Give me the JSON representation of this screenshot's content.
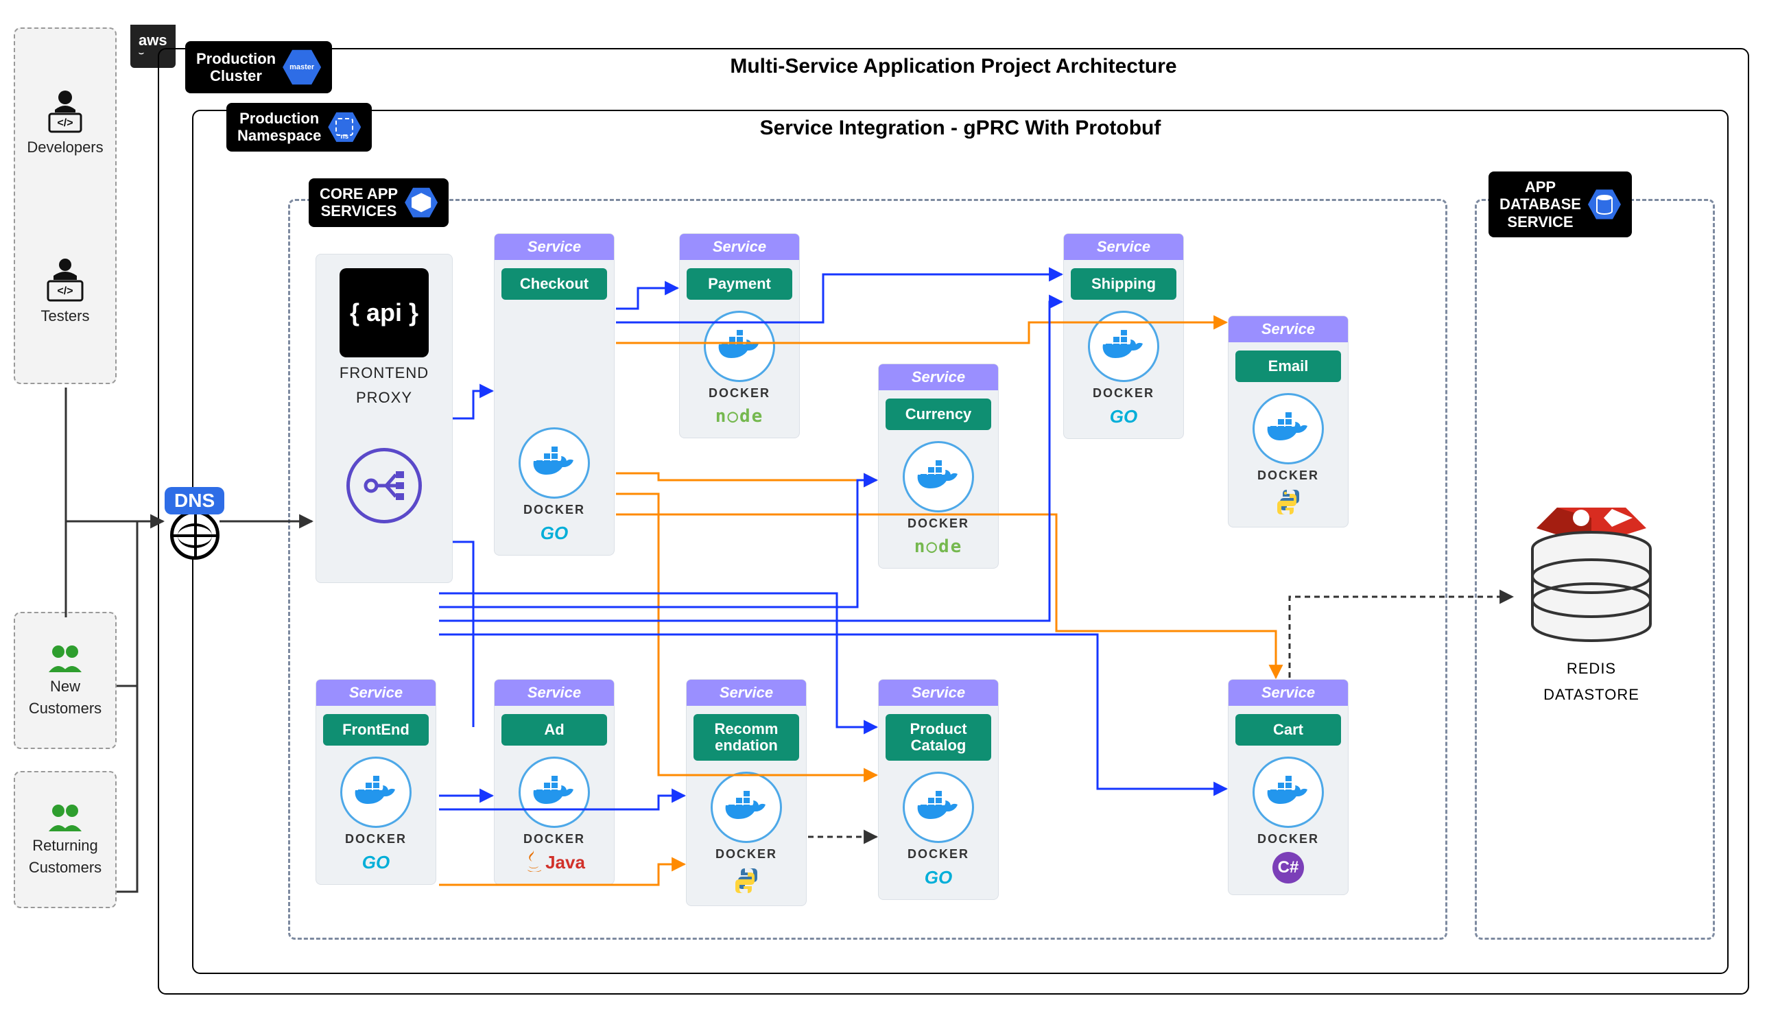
{
  "actors": {
    "developers": "Developers",
    "testers": "Testers",
    "new_customers_l1": "New",
    "new_customers_l2": "Customers",
    "returning_customers_l1": "Returning",
    "returning_customers_l2": "Customers"
  },
  "aws_label": "aws",
  "badges": {
    "prod_cluster_l1": "Production",
    "prod_cluster_l2": "Cluster",
    "prod_cluster_hex": "master",
    "prod_ns_l1": "Production",
    "prod_ns_l2": "Namespace",
    "prod_ns_hex": "ns",
    "core_app_l1": "CORE APP",
    "core_app_l2": "SERVICES",
    "app_db_l1": "APP",
    "app_db_l2": "DATABASE",
    "app_db_l3": "SERVICE"
  },
  "titles": {
    "outer": "Multi-Service Application Project Architecture",
    "inner": "Service Integration - gPRC With Protobuf"
  },
  "dns": "DNS",
  "proxy": {
    "api": "{ api }",
    "label_l1": "FRONTEND",
    "label_l2": "PROXY"
  },
  "svc_head": "Service",
  "docker_label": "DOCKER",
  "services": {
    "checkout": {
      "name": "Checkout",
      "lang": "go",
      "lang_text": "GO"
    },
    "payment": {
      "name": "Payment",
      "lang": "node",
      "lang_text": "n○de"
    },
    "shipping": {
      "name": "Shipping",
      "lang": "go",
      "lang_text": "GO"
    },
    "email": {
      "name": "Email",
      "lang": "py"
    },
    "currency": {
      "name": "Currency",
      "lang": "node",
      "lang_text": "n○de"
    },
    "frontend": {
      "name": "FrontEnd",
      "lang": "go",
      "lang_text": "GO"
    },
    "ad": {
      "name": "Ad",
      "lang": "java",
      "lang_text": "Java"
    },
    "recommendation": {
      "name_l1": "Recomm",
      "name_l2": "endation",
      "lang": "py"
    },
    "product_catalog": {
      "name_l1": "Product",
      "name_l2": "Catalog",
      "lang": "go",
      "lang_text": "GO"
    },
    "cart": {
      "name": "Cart",
      "lang": "cs",
      "lang_text": "C#"
    }
  },
  "redis": {
    "l1": "REDIS",
    "l2": "DATASTORE"
  },
  "colors": {
    "service_head": "#9a8fff",
    "service_name": "#0f8f72",
    "hex": "#2E6DE6",
    "go": "#00aed8",
    "wire_blue": "#1636ff",
    "wire_orange": "#ff8a00",
    "wire_dash": "#333333"
  }
}
